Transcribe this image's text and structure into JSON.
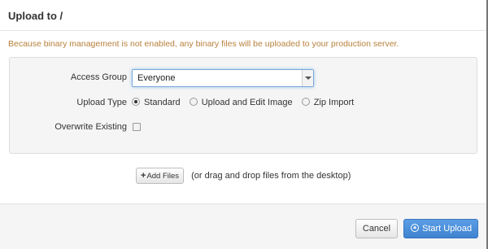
{
  "header": {
    "title": "Upload to /"
  },
  "notice": "Because binary management is not enabled, any binary files will be uploaded to your production server.",
  "form": {
    "access_group": {
      "label": "Access Group",
      "value": "Everyone"
    },
    "upload_type": {
      "label": "Upload Type",
      "options": [
        "Standard",
        "Upload and Edit Image",
        "Zip Import"
      ],
      "selected": "Standard"
    },
    "overwrite": {
      "label": "Overwrite Existing",
      "checked": false
    }
  },
  "add_files": {
    "label": "Add Files",
    "hint": "(or drag and drop files from the desktop)"
  },
  "footer": {
    "cancel_label": "Cancel",
    "start_label": "Start Upload"
  }
}
